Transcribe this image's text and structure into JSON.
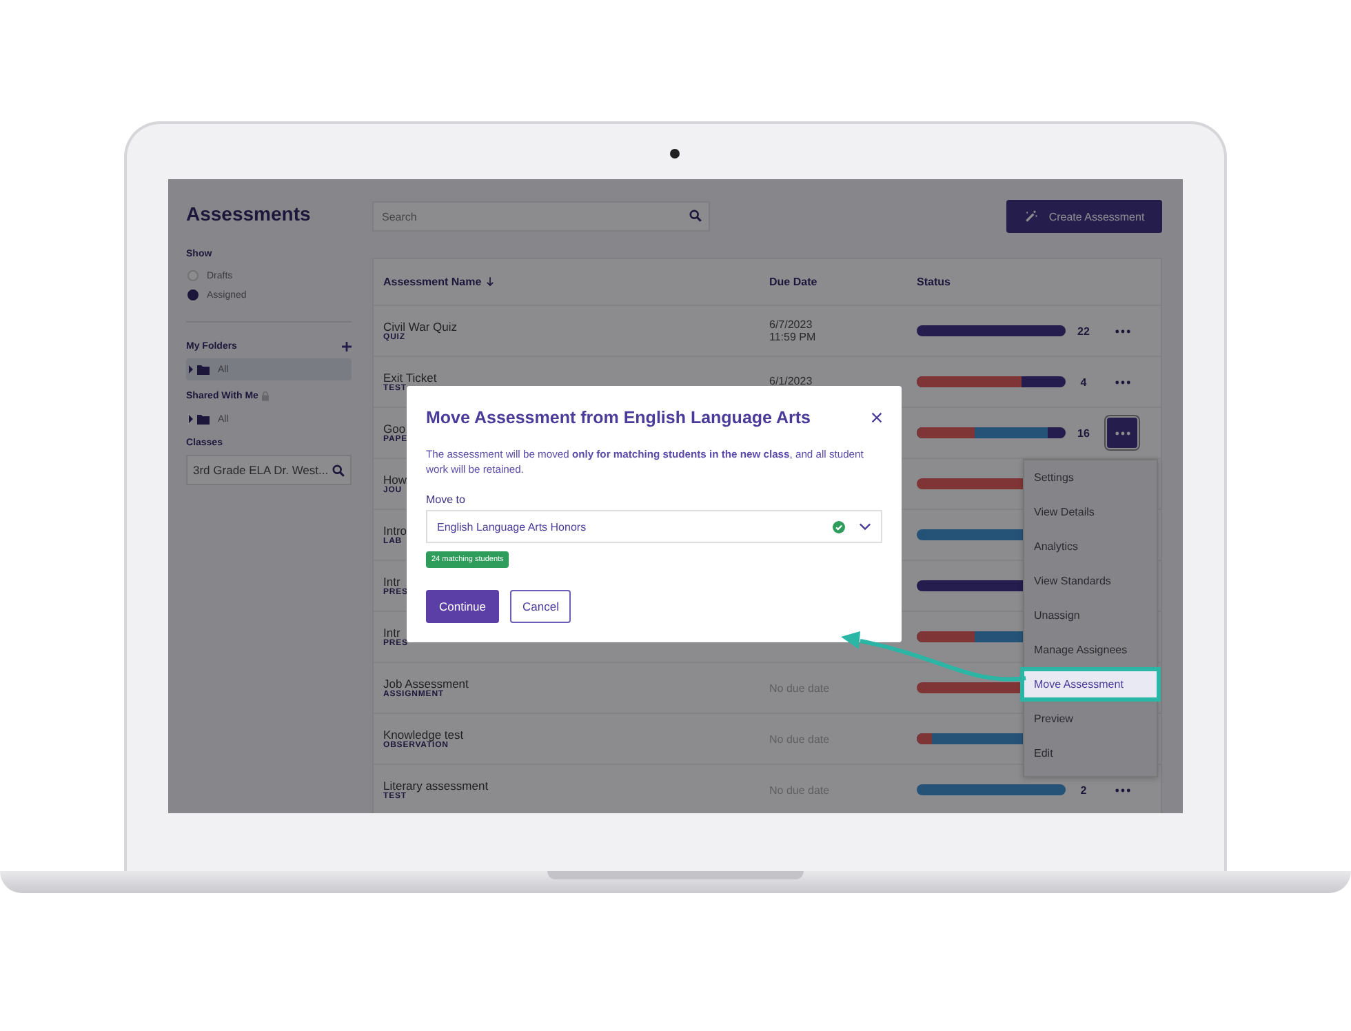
{
  "sidebar": {
    "title": "Assessments",
    "show_label": "Show",
    "show_options": [
      {
        "label": "Drafts",
        "selected": false
      },
      {
        "label": "Assigned",
        "selected": true
      }
    ],
    "my_folders": {
      "label": "My Folders",
      "items": [
        {
          "label": "All",
          "selected": true
        }
      ]
    },
    "shared": {
      "label": "Shared With Me",
      "items": [
        {
          "label": "All",
          "selected": false
        }
      ]
    },
    "classes": {
      "label": "Classes",
      "value": "3rd Grade ELA Dr. West..."
    }
  },
  "search": {
    "placeholder": "Search"
  },
  "create_button": "Create Assessment",
  "table": {
    "columns": [
      "Assessment Name",
      "Due Date",
      "Status"
    ],
    "rows": [
      {
        "name": "Civil War Quiz",
        "type": "QUIZ",
        "due": [
          "6/7/2023",
          "11:59 PM"
        ],
        "segments": [
          {
            "color": "#251d4d",
            "level": 1
          }
        ],
        "count": "22",
        "selected": false
      },
      {
        "name": "Exit Ticket",
        "type": "TEST",
        "due": [
          "6/1/2023"
        ],
        "segments": [
          {
            "color": "#7f3535",
            "level": 0.7
          },
          {
            "color": "#251d4d",
            "level": 1
          }
        ],
        "count": "4",
        "selected": false
      },
      {
        "name": "Goo",
        "type": "PAPE",
        "due": [],
        "segments": [
          {
            "color": "#7f3535",
            "level": 0.39
          },
          {
            "color": "#255377",
            "level": 0.88
          },
          {
            "color": "#251d4d",
            "level": 1
          }
        ],
        "count": "16",
        "selected": true
      },
      {
        "name": "How",
        "type": "JOU",
        "due": [],
        "segments": [
          {
            "color": "#7f3535",
            "level": 1
          }
        ],
        "count": ""
      },
      {
        "name": "Intro",
        "type": "LAB",
        "due": [],
        "segments": [
          {
            "color": "#255377",
            "level": 1
          }
        ],
        "count": ""
      },
      {
        "name": "Intr",
        "type": "PRES",
        "due": [],
        "segments": [
          {
            "color": "#251d4d",
            "level": 1
          }
        ],
        "count": ""
      },
      {
        "name": "Intr",
        "type": "PRES",
        "due": [],
        "segments": [
          {
            "color": "#7f3535",
            "level": 0.39
          },
          {
            "color": "#255377",
            "level": 1
          }
        ],
        "count": ""
      },
      {
        "name": "Job Assessment",
        "type": "ASSIGNMENT",
        "due": [
          "No due date"
        ],
        "segments": [
          {
            "color": "#7f3535",
            "level": 1
          }
        ],
        "count": ""
      },
      {
        "name": "Knowledge test",
        "type": "OBSERVATION",
        "due": [
          "No due date"
        ],
        "segments": [
          {
            "color": "#7f3535",
            "level": 0.1
          },
          {
            "color": "#255377",
            "level": 1
          }
        ],
        "count": ""
      },
      {
        "name": "Literary assessment",
        "type": "TEST",
        "due": [
          "No due date"
        ],
        "segments": [
          {
            "color": "#255377",
            "level": 1
          }
        ],
        "count": "2",
        "selected": false
      }
    ]
  },
  "menu": [
    {
      "label": "Settings",
      "selected": false
    },
    {
      "label": "View Details",
      "selected": false
    },
    {
      "label": "Analytics",
      "selected": false
    },
    {
      "label": "View Standards",
      "selected": false
    },
    {
      "label": "Unassign",
      "selected": false
    },
    {
      "label": "Manage Assignees",
      "selected": false
    },
    {
      "label": "Move Assessment",
      "selected": true
    },
    {
      "label": "Preview",
      "selected": false
    },
    {
      "label": "Edit",
      "selected": false
    }
  ],
  "modal": {
    "title": "Move Assessment from English Language Arts",
    "body": "The assessment will be moved **only for matching students in the new class**, and all student work will be retained.",
    "field_label": "Move to",
    "value": "English Language Arts Honors",
    "valid": true,
    "badge": "24 matching students",
    "buttons": [
      {
        "label": "Continue",
        "kind": "primary"
      },
      {
        "label": "Cancel",
        "kind": "secondary"
      }
    ]
  }
}
